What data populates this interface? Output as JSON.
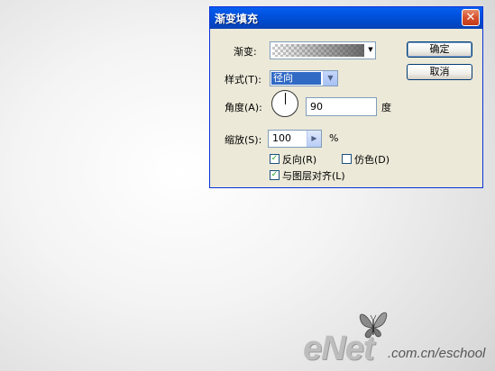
{
  "dialog": {
    "title": "渐变填充",
    "close_glyph": "✕",
    "gradient_label": "渐变:",
    "style_label": "样式(T):",
    "style_value": "径向",
    "angle_label": "角度(A):",
    "angle_value": "90",
    "angle_unit": "度",
    "scale_label": "缩放(S):",
    "scale_value": "100",
    "scale_unit": "%",
    "reverse_label": "反向(R)",
    "reverse_checked": true,
    "dither_label": "仿色(D)",
    "dither_checked": false,
    "align_label": "与图层对齐(L)",
    "align_checked": true,
    "ok_label": "确定",
    "cancel_label": "取消",
    "icons": {
      "dropdown": "▼",
      "stepper": "▶",
      "check": "✓"
    }
  },
  "watermark": {
    "brand": "eNet",
    "rest": ".com.cn/eschool"
  },
  "colors": {
    "titlebar": "#0054e3",
    "dialog_bg": "#ece9d8",
    "selection": "#316ac5",
    "close_button": "#d6502d"
  }
}
